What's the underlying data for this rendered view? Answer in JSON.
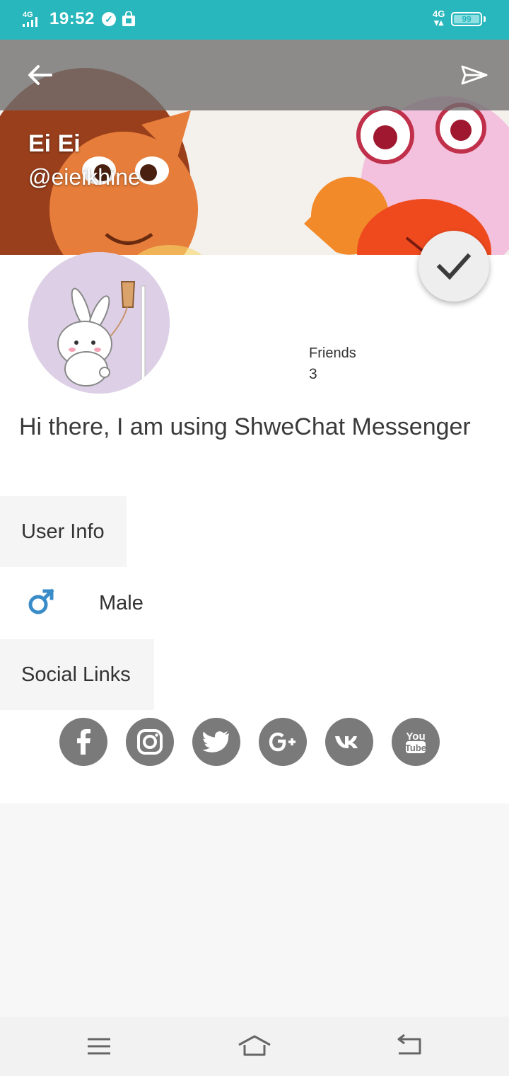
{
  "status_bar": {
    "network": "4G",
    "time": "19:52",
    "right_network": "4G",
    "battery": "99"
  },
  "profile": {
    "name": "Ei Ei",
    "handle": "@eieikhine",
    "friends_label": "Friends",
    "friends_count": "3",
    "bio": "Hi there, I am using ShweChat Messenger"
  },
  "sections": {
    "user_info": "User Info",
    "gender": "Male",
    "social_links": "Social Links"
  },
  "social_icons": [
    "facebook-icon",
    "instagram-icon",
    "twitter-icon",
    "google-plus-icon",
    "vk-icon",
    "youtube-icon"
  ],
  "colors": {
    "status_bar": "#28b7bd",
    "social_icon_bg": "#7a7a7a",
    "gender_icon": "#3a8cc8"
  }
}
